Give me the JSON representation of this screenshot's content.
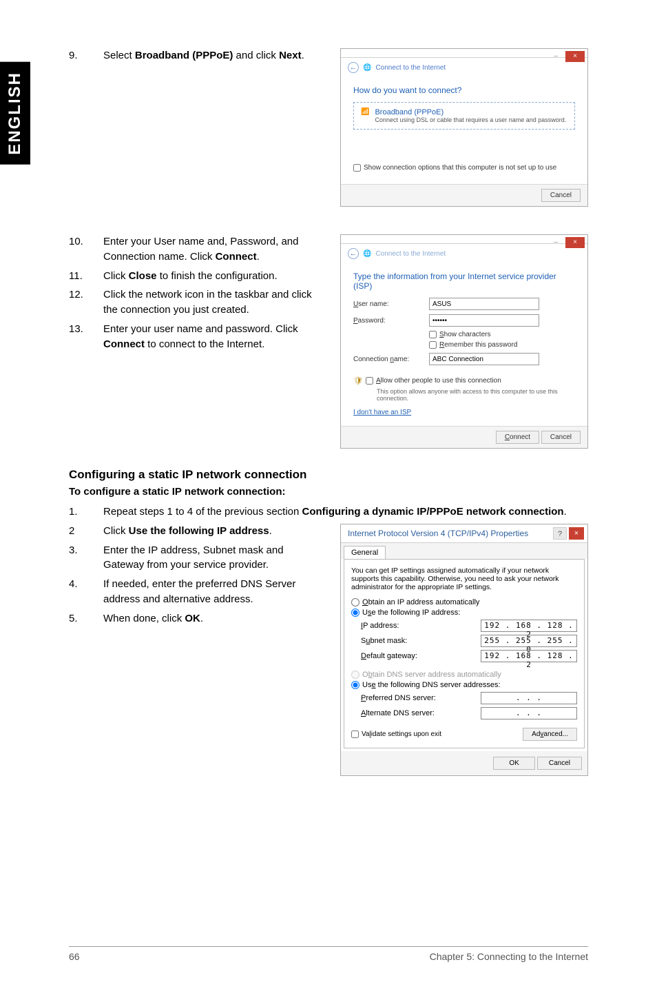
{
  "lang_tab": "ENGLISH",
  "step9": {
    "num": "9.",
    "text_pre": "Select ",
    "bold1": "Broadband (PPPoE)",
    "text_mid": " and click ",
    "bold2": "Next",
    "text_post": "."
  },
  "dialog1": {
    "title": "Connect to the Internet",
    "heading": "How do you want to connect?",
    "pppoe_title": "Broadband (PPPoE)",
    "pppoe_desc": "Connect using DSL or cable that requires a user name and password.",
    "show_opts": "Show connection options that this computer is not set up to use",
    "cancel": "Cancel"
  },
  "step10": {
    "num": "10.",
    "text1": "Enter your User name and, Password, and Connection name. Click ",
    "bold": "Connect",
    "text2": "."
  },
  "step11": {
    "num": "11.",
    "text1": "Click ",
    "bold": "Close",
    "text2": " to finish the configuration."
  },
  "step12": {
    "num": "12.",
    "text": "Click the network icon in the taskbar and click the connection you just created."
  },
  "step13": {
    "num": "13.",
    "text1": "Enter your user name and password. Click ",
    "bold": "Connect",
    "text2": " to connect to the Internet."
  },
  "dialog2": {
    "title": "Connect to the Internet",
    "heading": "Type the information from your Internet service provider (ISP)",
    "user_label": "User name:",
    "user_val": "ASUS",
    "pass_label": "Password:",
    "pass_val": "••••••",
    "show_chars": "Show characters",
    "remember": "Remember this password",
    "conn_label": "Connection name:",
    "conn_val": "ABC Connection",
    "allow_others": "Allow other people to use this connection",
    "allow_desc": "This option allows anyone with access to this computer to use this connection.",
    "no_isp": "I don't have an ISP",
    "connect": "Connect",
    "cancel": "Cancel"
  },
  "static_h3": "Configuring a static IP network connection",
  "static_h4": "To configure a static IP network connection:",
  "sstep1": {
    "num": "1.",
    "text1": "Repeat steps 1 to 4 of the previous section ",
    "bold": "Configuring a dynamic IP/PPPoE network connection",
    "text2": "."
  },
  "sstep2": {
    "num": "2",
    "text1": "Click ",
    "bold": "Use the following IP address",
    "text2": "."
  },
  "sstep3": {
    "num": "3.",
    "text": "Enter the IP address, Subnet mask and Gateway from your service provider."
  },
  "sstep4": {
    "num": "4.",
    "text": "If needed, enter the preferred DNS Server address and alternative address."
  },
  "sstep5": {
    "num": "5.",
    "text1": "When done, click ",
    "bold": "OK",
    "text2": "."
  },
  "ipv4": {
    "title": "Internet Protocol Version 4 (TCP/IPv4) Properties",
    "tab": "General",
    "desc": "You can get IP settings assigned automatically if your network supports this capability. Otherwise, you need to ask your network administrator for the appropriate IP settings.",
    "radio_auto_ip": "Obtain an IP address automatically",
    "radio_use_ip": "Use the following IP address:",
    "ip_label": "IP address:",
    "ip_val": "192 . 168 . 128 .  2",
    "mask_label": "Subnet mask:",
    "mask_val": "255 . 255 . 255 .  0",
    "gw_label": "Default gateway:",
    "gw_val": "192 . 168 . 128 .  2",
    "radio_auto_dns": "Obtain DNS server address automatically",
    "radio_use_dns": "Use the following DNS server addresses:",
    "pref_dns_label": "Preferred DNS server:",
    "pref_dns_val": ".       .       .",
    "alt_dns_label": "Alternate DNS server:",
    "alt_dns_val": ".       .       .",
    "validate": "Validate settings upon exit",
    "advanced": "Advanced...",
    "ok": "OK",
    "cancel": "Cancel"
  },
  "footer": {
    "page": "66",
    "chapter": "Chapter 5: Connecting to the Internet"
  }
}
